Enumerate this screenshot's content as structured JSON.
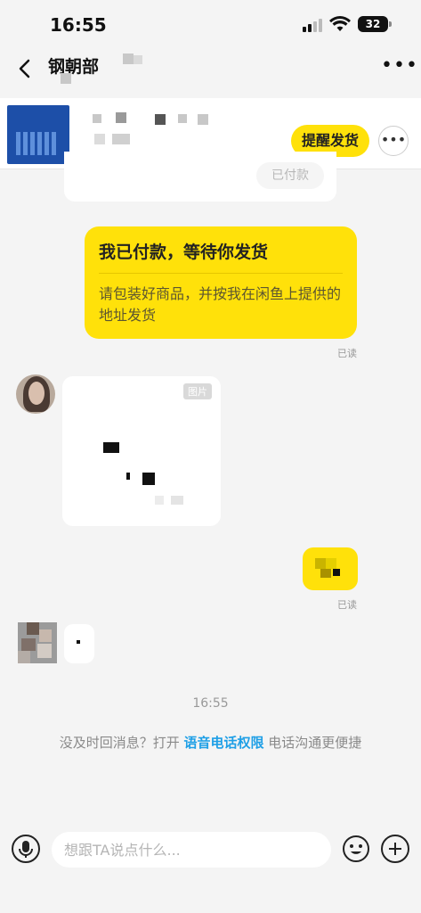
{
  "status_bar": {
    "time": "16:55",
    "battery": "32",
    "icons": [
      "signal-icon",
      "wifi-icon",
      "battery-icon"
    ]
  },
  "nav": {
    "title": "钢朝部",
    "back_icon": "chevron-left-icon",
    "more_label": "•••"
  },
  "order": {
    "remind_label": "提醒发货",
    "more_label": "•••",
    "prev_status": "已付款"
  },
  "messages": {
    "paid_title": "我已付款，等待你发货",
    "paid_desc": "请包装好商品，并按我在闲鱼上提供的地址发货",
    "read_label_1": "已读",
    "image_tag": "图片",
    "read_label_2": "已读"
  },
  "system": {
    "timestamp": "16:55",
    "hint_prefix": "没及时回消息？打开",
    "hint_link": "语音电话权限",
    "hint_suffix": "电话沟通更便捷"
  },
  "input": {
    "placeholder": "想跟TA说点什么..."
  },
  "colors": {
    "accent": "#ffe10a",
    "link": "#1e9fe6",
    "background": "#f4f4f4"
  }
}
